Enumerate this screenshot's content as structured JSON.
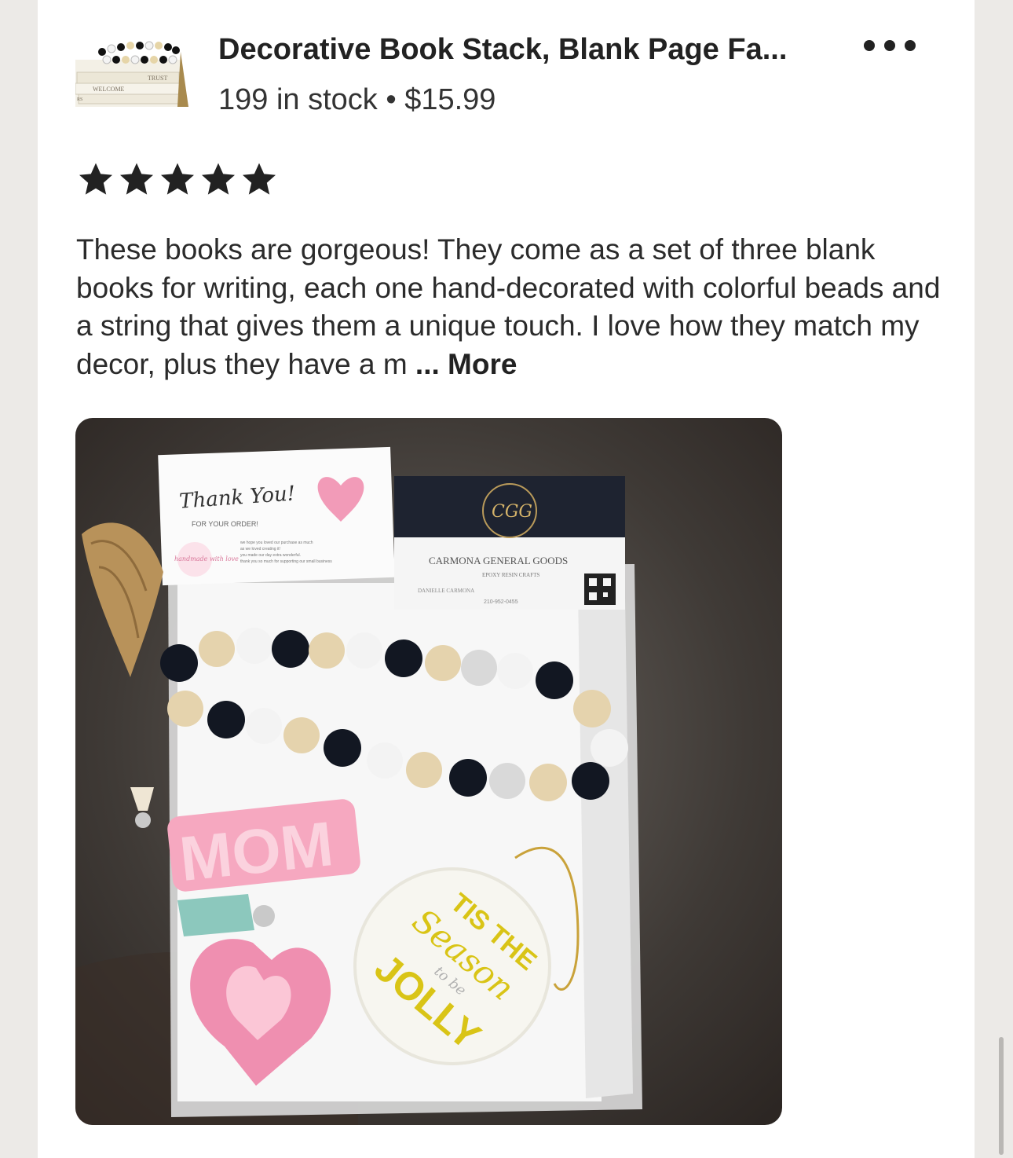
{
  "listing": {
    "title": "Decorative Book Stack, Blank Page Fa...",
    "meta": "199 in stock • $15.99",
    "thumbnail_text": [
      "TRUST",
      "WELCOME",
      "RS"
    ]
  },
  "review": {
    "rating": 5,
    "text": "These books are gorgeous! They come as a set of three blank books for writing, each one hand-decorated with colorful beads and a string that gives them a unique touch. I love how they match my decor, plus they have a m",
    "more_label": "... More"
  },
  "photo": {
    "thank_you_card": {
      "heading": "Thank You!",
      "subheading": "FOR YOUR ORDER!",
      "badge": "handmade with love",
      "body": [
        "we hope you loved our purchase as much",
        "as we loved creating it!",
        "you made our day extra wonderful.",
        "thank you so much for supporting our small business"
      ]
    },
    "business_card": {
      "monogram": "CGG",
      "name": "CARMONA GENERAL GOODS",
      "tagline": "EPOXY RESIN CRAFTS",
      "owner": "DANIELLE CARMONA",
      "phone": "210-952-0455"
    },
    "keychain_text": "MOM",
    "ornament_text": [
      "TIS THE",
      "Season",
      "to be",
      "JOLLY"
    ]
  },
  "colors": {
    "text": "#222222",
    "page_bg": "#eceae7",
    "card_bg": "#ffffff",
    "pink": "#f29bb8",
    "gold": "#d9c416"
  }
}
